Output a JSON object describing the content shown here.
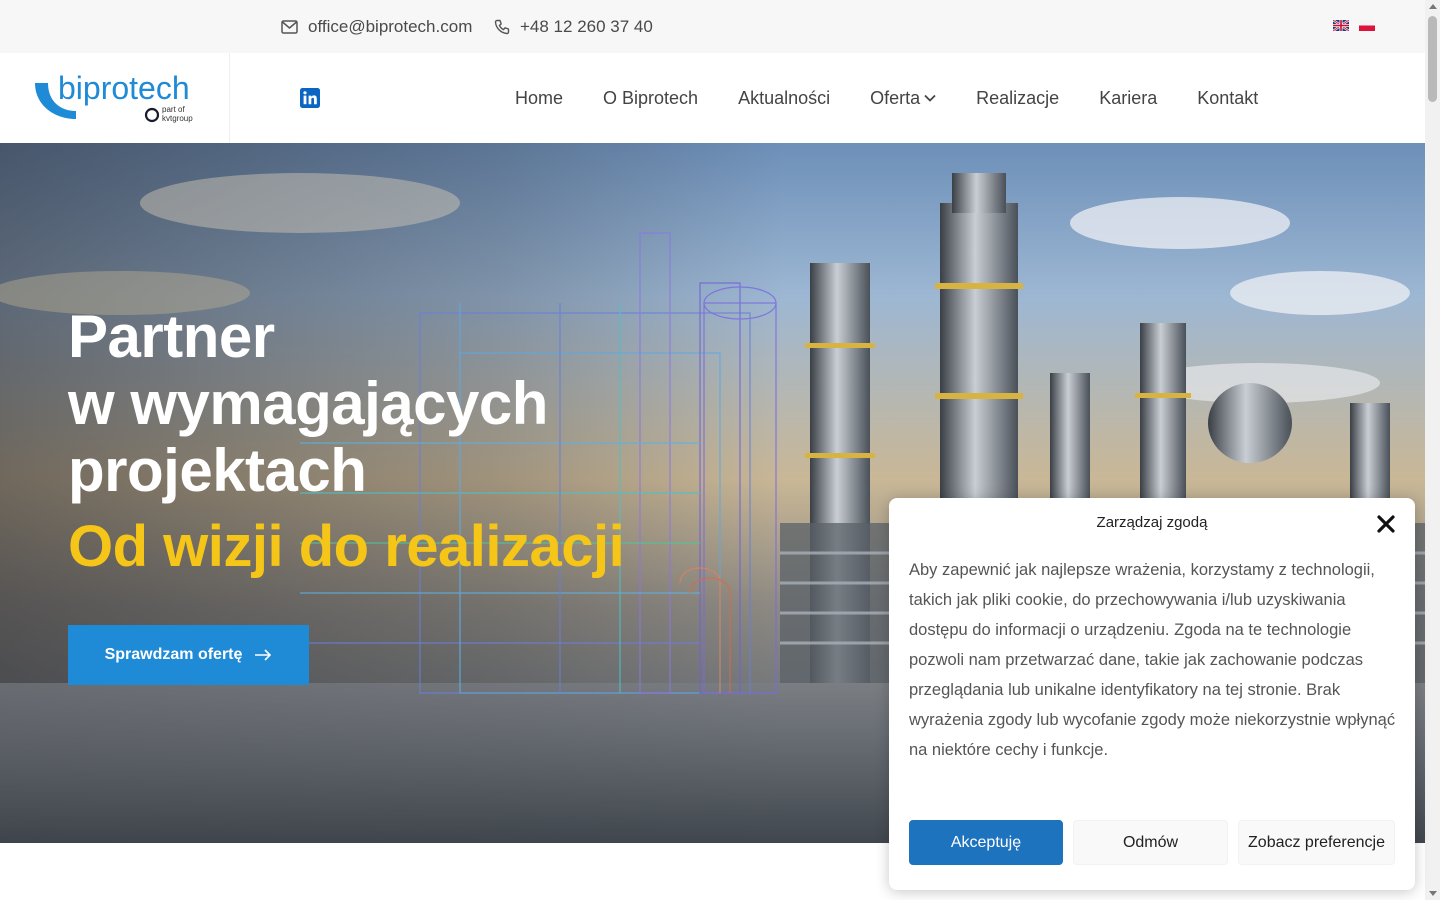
{
  "topbar": {
    "email": "office@biprotech.com",
    "phone": "+48 12 260 37 40",
    "languages": [
      "English",
      "Polski"
    ]
  },
  "header": {
    "logo_text": "biprotech",
    "logo_tagline_1": "part of",
    "logo_tagline_2": "kvtgroup",
    "nav": {
      "home": "Home",
      "about": "O Biprotech",
      "news": "Aktualności",
      "offer": "Oferta",
      "projects": "Realizacje",
      "career": "Kariera",
      "contact": "Kontakt"
    }
  },
  "hero": {
    "title_line_1": "Partner",
    "title_line_2": "w wymagających",
    "title_line_3": "projektach",
    "subtitle": "Od wizji do realizacji",
    "cta": "Sprawdzam ofertę"
  },
  "cookie": {
    "title": "Zarządzaj zgodą",
    "text": "Aby zapewnić jak najlepsze wrażenia, korzystamy z technologii, takich jak pliki cookie, do przechowywania i/lub uzyskiwania dostępu do informacji o urządzeniu. Zgoda na te technologie pozwoli nam przetwarzać dane, takie jak zachowanie podczas przeglądania lub unikalne identyfikatory na tej stronie. Brak wyrażenia zgody lub wycofanie zgody może niekorzystnie wpłynąć na niektóre cechy i funkcje.",
    "accept": "Akceptuję",
    "deny": "Odmów",
    "preferences": "Zobacz preferencje"
  },
  "colors": {
    "brand_blue": "#1f8ad6",
    "accent_yellow": "#f5c518",
    "accept_blue": "#1e73be",
    "linkedin_blue": "#0a66c2"
  },
  "icons": [
    "mail-icon",
    "phone-icon",
    "flag-uk-icon",
    "flag-pl-icon",
    "linkedin-icon",
    "chevron-down-icon",
    "arrow-right-icon",
    "close-icon"
  ]
}
